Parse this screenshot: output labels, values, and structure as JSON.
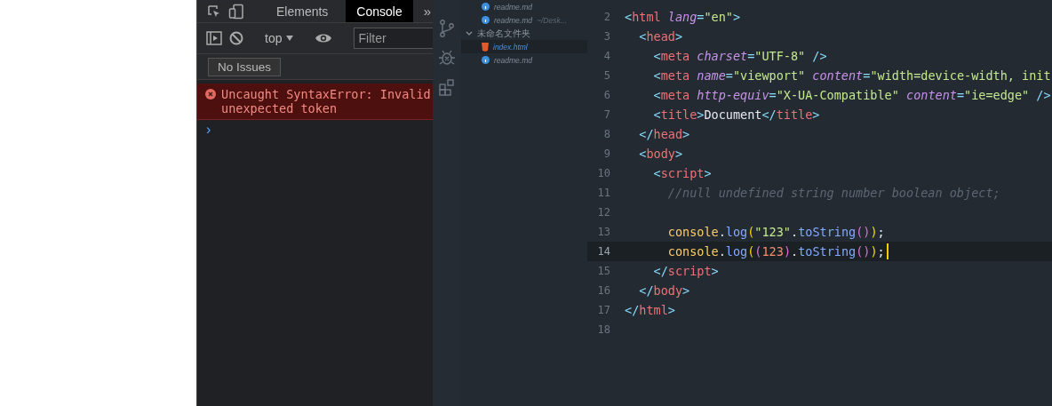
{
  "devtools": {
    "tabs": [
      {
        "label": "Elements",
        "selected": false
      },
      {
        "label": "Console",
        "selected": true
      }
    ],
    "more": "»",
    "context": "top",
    "filter": {
      "placeholder": "Filter"
    },
    "issues": "No Issues",
    "error": {
      "lines": [
        "Uncaught SyntaxError: Invalid",
        "unexpected token"
      ]
    },
    "prompt": "›"
  },
  "explorer": {
    "items": [
      {
        "kind": "md",
        "name": "readme.md",
        "selected": false
      },
      {
        "kind": "md",
        "name": "readme.md",
        "path": "~/Desk...",
        "selected": false
      },
      {
        "kind": "folder",
        "name": "未命名文件夹",
        "selected": false
      },
      {
        "kind": "html",
        "name": "index.html",
        "selected": true
      },
      {
        "kind": "md",
        "name": "readme.md",
        "selected": false
      }
    ]
  },
  "editor": {
    "lines": [
      {
        "number": "2",
        "current": false,
        "tokens": [
          {
            "text": "<",
            "kind": "p"
          },
          {
            "text": "html",
            "kind": "tag"
          },
          {
            "text": " lang",
            "kind": "attr"
          },
          {
            "text": "=",
            "kind": "p"
          },
          {
            "text": "\"en\"",
            "kind": "str"
          },
          {
            "text": ">",
            "kind": "p"
          }
        ]
      },
      {
        "number": "3",
        "current": false,
        "tokens": [
          {
            "text": "  <",
            "kind": "p"
          },
          {
            "text": "head",
            "kind": "tag"
          },
          {
            "text": ">",
            "kind": "p"
          }
        ]
      },
      {
        "number": "4",
        "current": false,
        "tokens": [
          {
            "text": "    <",
            "kind": "p"
          },
          {
            "text": "meta",
            "kind": "tag"
          },
          {
            "text": " charset",
            "kind": "attr"
          },
          {
            "text": "=",
            "kind": "p"
          },
          {
            "text": "\"UTF-8\"",
            "kind": "str"
          },
          {
            "text": " />",
            "kind": "p"
          }
        ]
      },
      {
        "number": "5",
        "current": false,
        "tokens": [
          {
            "text": "    <",
            "kind": "p"
          },
          {
            "text": "meta",
            "kind": "tag"
          },
          {
            "text": " name",
            "kind": "attr"
          },
          {
            "text": "=",
            "kind": "p"
          },
          {
            "text": "\"viewport\"",
            "kind": "str"
          },
          {
            "text": " content",
            "kind": "attr"
          },
          {
            "text": "=",
            "kind": "p"
          },
          {
            "text": "\"width=device-width, init",
            "kind": "str"
          }
        ]
      },
      {
        "number": "6",
        "current": false,
        "tokens": [
          {
            "text": "    <",
            "kind": "p"
          },
          {
            "text": "meta",
            "kind": "tag"
          },
          {
            "text": " http-equiv",
            "kind": "attr"
          },
          {
            "text": "=",
            "kind": "p"
          },
          {
            "text": "\"X-UA-Compatible\"",
            "kind": "str"
          },
          {
            "text": " content",
            "kind": "attr"
          },
          {
            "text": "=",
            "kind": "p"
          },
          {
            "text": "\"ie=edge\"",
            "kind": "str"
          },
          {
            "text": " />",
            "kind": "p"
          }
        ]
      },
      {
        "number": "7",
        "current": false,
        "tokens": [
          {
            "text": "    <",
            "kind": "p"
          },
          {
            "text": "title",
            "kind": "tag"
          },
          {
            "text": ">",
            "kind": "p"
          },
          {
            "text": "Document",
            "kind": "t"
          },
          {
            "text": "</",
            "kind": "p"
          },
          {
            "text": "title",
            "kind": "tag"
          },
          {
            "text": ">",
            "kind": "p"
          }
        ]
      },
      {
        "number": "8",
        "current": false,
        "tokens": [
          {
            "text": "  </",
            "kind": "p"
          },
          {
            "text": "head",
            "kind": "tag"
          },
          {
            "text": ">",
            "kind": "p"
          }
        ]
      },
      {
        "number": "9",
        "current": false,
        "tokens": [
          {
            "text": "  <",
            "kind": "p"
          },
          {
            "text": "body",
            "kind": "tag"
          },
          {
            "text": ">",
            "kind": "p"
          }
        ]
      },
      {
        "number": "10",
        "current": false,
        "tokens": [
          {
            "text": "    <",
            "kind": "p"
          },
          {
            "text": "script",
            "kind": "tag"
          },
          {
            "text": ">",
            "kind": "p"
          }
        ]
      },
      {
        "number": "11",
        "current": false,
        "tokens": [
          {
            "text": "      //null undefined string number boolean object;",
            "kind": "comment"
          }
        ]
      },
      {
        "number": "12",
        "current": false
      },
      {
        "number": "13",
        "current": false,
        "tokens": [
          {
            "text": "      console",
            "kind": "obj"
          },
          {
            "text": ".",
            "kind": "t"
          },
          {
            "text": "log",
            "kind": "fn"
          },
          {
            "text": "(",
            "kind": "paren"
          },
          {
            "text": "\"123\"",
            "kind": "str"
          },
          {
            "text": ".",
            "kind": "t"
          },
          {
            "text": "toString",
            "kind": "fn"
          },
          {
            "text": "()",
            "kind": "paren2"
          },
          {
            "text": ")",
            "kind": "paren"
          },
          {
            "text": ";",
            "kind": "t"
          }
        ]
      },
      {
        "number": "14",
        "current": true,
        "tokens": [
          {
            "text": "      console",
            "kind": "obj"
          },
          {
            "text": ".",
            "kind": "t"
          },
          {
            "text": "log",
            "kind": "fn"
          },
          {
            "text": "(",
            "kind": "paren"
          },
          {
            "text": "(",
            "kind": "paren2"
          },
          {
            "text": "123",
            "kind": "num"
          },
          {
            "text": ")",
            "kind": "paren2"
          },
          {
            "text": ".",
            "kind": "t"
          },
          {
            "text": "toString",
            "kind": "fn"
          },
          {
            "text": "()",
            "kind": "paren2"
          },
          {
            "text": ")",
            "kind": "paren"
          },
          {
            "text": ";",
            "kind": "t"
          }
        ]
      },
      {
        "number": "15",
        "current": false,
        "tokens": [
          {
            "text": "    </",
            "kind": "p"
          },
          {
            "text": "script",
            "kind": "tag"
          },
          {
            "text": ">",
            "kind": "p"
          }
        ]
      },
      {
        "number": "16",
        "current": false,
        "tokens": [
          {
            "text": "  </",
            "kind": "p"
          },
          {
            "text": "body",
            "kind": "tag"
          },
          {
            "text": ">",
            "kind": "p"
          }
        ]
      },
      {
        "number": "17",
        "current": false,
        "tokens": [
          {
            "text": "</",
            "kind": "p"
          },
          {
            "text": "html",
            "kind": "tag"
          },
          {
            "text": ">",
            "kind": "p"
          }
        ]
      },
      {
        "number": "18",
        "current": false
      }
    ]
  }
}
